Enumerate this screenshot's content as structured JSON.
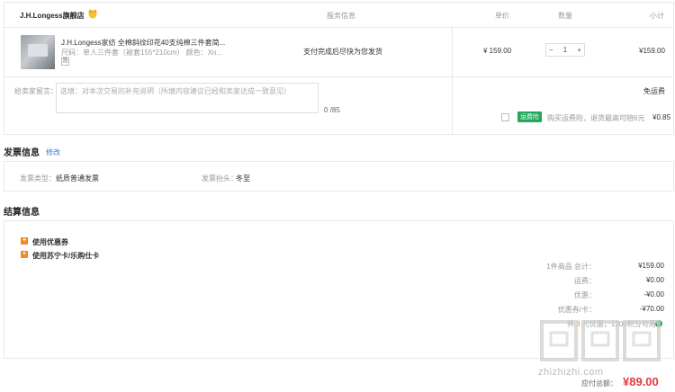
{
  "header": {
    "store_name": "J.H.Longess旗舰店",
    "col_service": "服务信息",
    "col_price": "单价",
    "col_qty": "数量",
    "col_subtotal": "小计"
  },
  "item": {
    "name": "J.H.Longess家纺 全棉斜纹印花40支纯棉三件套简...",
    "spec": "尺码：单人三件套（被套155*210cm）   颜色：Xn...",
    "spec_tag": "圆",
    "service": "支付完成后尽快为您发货",
    "price": "¥ 159.00",
    "qty_minus": "−",
    "qty": "1",
    "qty_plus": "+",
    "subtotal": "¥159.00"
  },
  "message": {
    "label": "给卖家留言：",
    "placeholder": "选填：对本次交易的补充说明（所填内容建议已经和卖家达成一致意见）",
    "count": "0 /85"
  },
  "shipping": {
    "free": "免运费",
    "insurance_tag": "运费险",
    "insurance_text": "购买运费险，退货最高可赔6元",
    "insurance_price": "¥0.85"
  },
  "invoice": {
    "title": "发票信息",
    "edit": "修改",
    "type_label": "发票类型：",
    "type_value": "纸质普通发票",
    "header_label": "发票抬头：",
    "header_value": "冬至"
  },
  "settlement": {
    "title": "结算信息",
    "options": [
      "使用优惠券",
      "使用苏宁卡/乐购仕卡"
    ],
    "summary": [
      {
        "label": "1件商品  总计：",
        "value": "¥159.00"
      },
      {
        "label": "运费：",
        "value": "¥0.00"
      },
      {
        "label": "优惠：",
        "value": "-¥0.00"
      },
      {
        "label": "优惠券/卡：",
        "value": "-¥70.00"
      }
    ],
    "promo_prefix": "共",
    "promo_highlight": "3",
    "promo_suffix": "元优惠，1200积分可用",
    "pay_label": "应付总额：",
    "pay_value": "¥89.00"
  },
  "watermark": {
    "text": "zhizhizhi.com"
  }
}
